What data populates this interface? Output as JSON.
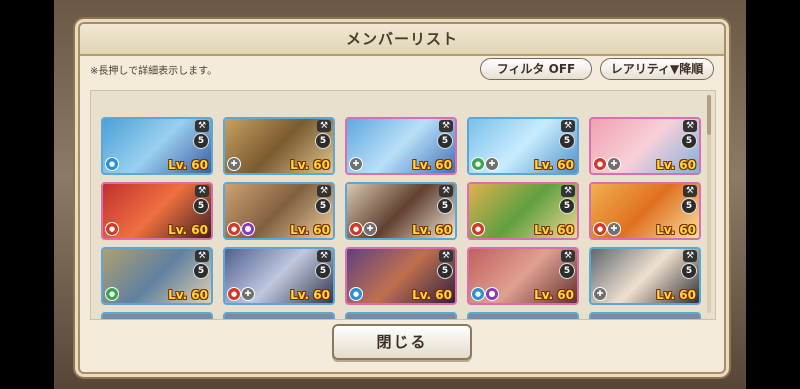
{
  "dialog": {
    "title": "メンバーリスト",
    "note": "※長押しで詳細表示します。",
    "filter_label": "フィルタ OFF",
    "sort_label": "レアリティ▼降順",
    "close_label": "閉じる"
  },
  "cards": [
    {
      "level": "Lv. 60",
      "rank": "5",
      "element": "water",
      "role": "none",
      "frame": "blue",
      "art": [
        "#4aa0d8",
        "#9ad0f0",
        "#3a5da0"
      ]
    },
    {
      "level": "Lv. 60",
      "rank": "5",
      "element": "none",
      "role": "sword",
      "frame": "blue",
      "art": [
        "#c8a060",
        "#7a5a30",
        "#e0c890"
      ]
    },
    {
      "level": "Lv. 60",
      "rank": "5",
      "element": "none",
      "role": "sword",
      "frame": "pink",
      "art": [
        "#60a8e0",
        "#b8e0f8",
        "#4070b8"
      ]
    },
    {
      "level": "Lv. 60",
      "rank": "5",
      "element": "wind",
      "role": "sword",
      "frame": "blue",
      "art": [
        "#7ac0e8",
        "#c8ecff",
        "#5090c8"
      ]
    },
    {
      "level": "Lv. 60",
      "rank": "5",
      "element": "fire",
      "role": "sword",
      "frame": "pink",
      "art": [
        "#f0a0b0",
        "#f8d0d8",
        "#80b0e0"
      ]
    },
    {
      "level": "Lv. 60",
      "rank": "5",
      "element": "fire",
      "role": "none",
      "frame": "pink",
      "art": [
        "#c03030",
        "#f07040",
        "#402020"
      ]
    },
    {
      "level": "Lv. 60",
      "rank": "5",
      "element": "fire",
      "role": "dark",
      "frame": "blue",
      "art": [
        "#d0a070",
        "#806040",
        "#f0d0a0"
      ]
    },
    {
      "level": "Lv. 60",
      "rank": "5",
      "element": "fire",
      "role": "sword",
      "frame": "blue",
      "art": [
        "#d8c8b0",
        "#604030",
        "#f0e8d8"
      ]
    },
    {
      "level": "Lv. 60",
      "rank": "5",
      "element": "fire",
      "role": "none",
      "frame": "pink",
      "art": [
        "#e0b050",
        "#60a040",
        "#f0d890"
      ]
    },
    {
      "level": "Lv. 60",
      "rank": "5",
      "element": "fire",
      "role": "sword",
      "frame": "pink",
      "art": [
        "#f0b050",
        "#e07020",
        "#f8e0a0"
      ]
    },
    {
      "level": "Lv. 60",
      "rank": "5",
      "element": "wind",
      "role": "none",
      "frame": "blue",
      "art": [
        "#b0a070",
        "#6080a0",
        "#e0d0b0"
      ]
    },
    {
      "level": "Lv. 60",
      "rank": "5",
      "element": "fire",
      "role": "sword",
      "frame": "blue",
      "art": [
        "#506090",
        "#c0c8e0",
        "#303850"
      ]
    },
    {
      "level": "Lv. 60",
      "rank": "5",
      "element": "water",
      "role": "none",
      "frame": "pink",
      "art": [
        "#604080",
        "#c07050",
        "#302040"
      ]
    },
    {
      "level": "Lv. 60",
      "rank": "5",
      "element": "water",
      "role": "dark",
      "frame": "pink",
      "art": [
        "#c06060",
        "#e0a090",
        "#603030"
      ]
    },
    {
      "level": "Lv. 60",
      "rank": "5",
      "element": "none",
      "role": "sword",
      "frame": "blue",
      "art": [
        "#606870",
        "#f0e0d0",
        "#303030"
      ]
    }
  ],
  "colors": {
    "fire": "#d03a2a",
    "water": "#2f8fd0",
    "wind": "#3aa84a",
    "dark": "#8a3ab8",
    "none": "#6a6a6a",
    "frame_blue": "#5aa8d8",
    "frame_pink": "#d86fb0"
  }
}
